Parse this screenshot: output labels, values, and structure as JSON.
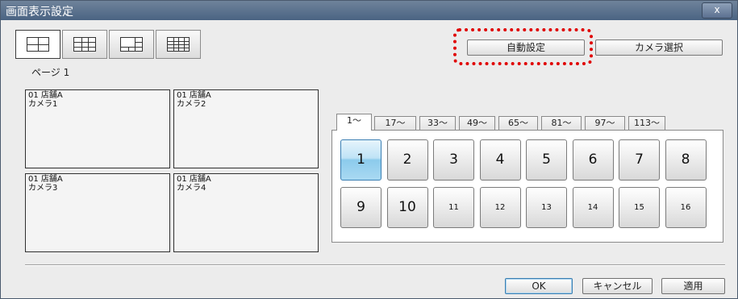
{
  "window": {
    "title": "画面表示設定",
    "close_label": "x"
  },
  "layouts": [
    {
      "name": "2x2",
      "rows": 2,
      "cols": 2,
      "selected": true
    },
    {
      "name": "3x3",
      "rows": 3,
      "cols": 3,
      "selected": false
    },
    {
      "name": "1+5",
      "rows": 3,
      "cols": 3,
      "selected": false
    },
    {
      "name": "4x4",
      "rows": 4,
      "cols": 4,
      "selected": false
    }
  ],
  "page_label": "ページ 1",
  "cameras": [
    {
      "store": "01 店舗A",
      "camera": "カメラ1"
    },
    {
      "store": "01 店舗A",
      "camera": "カメラ2"
    },
    {
      "store": "01 店舗A",
      "camera": "カメラ3"
    },
    {
      "store": "01 店舗A",
      "camera": "カメラ4"
    }
  ],
  "auto_button": "自動設定",
  "select_button": "カメラ選択",
  "tabs": [
    "1〜",
    "17〜",
    "33〜",
    "49〜",
    "65〜",
    "81〜",
    "97〜",
    "113〜"
  ],
  "active_tab": 0,
  "numbers": [
    "1",
    "2",
    "3",
    "4",
    "5",
    "6",
    "7",
    "8",
    "9",
    "10",
    "11",
    "12",
    "13",
    "14",
    "15",
    "16"
  ],
  "selected_number": "1",
  "buttons": {
    "ok": "OK",
    "cancel": "キャンセル",
    "apply": "適用"
  },
  "colors": {
    "titlebar": "#5a7090",
    "highlight": "#e00000",
    "selected_blue": "#8ccbec"
  }
}
